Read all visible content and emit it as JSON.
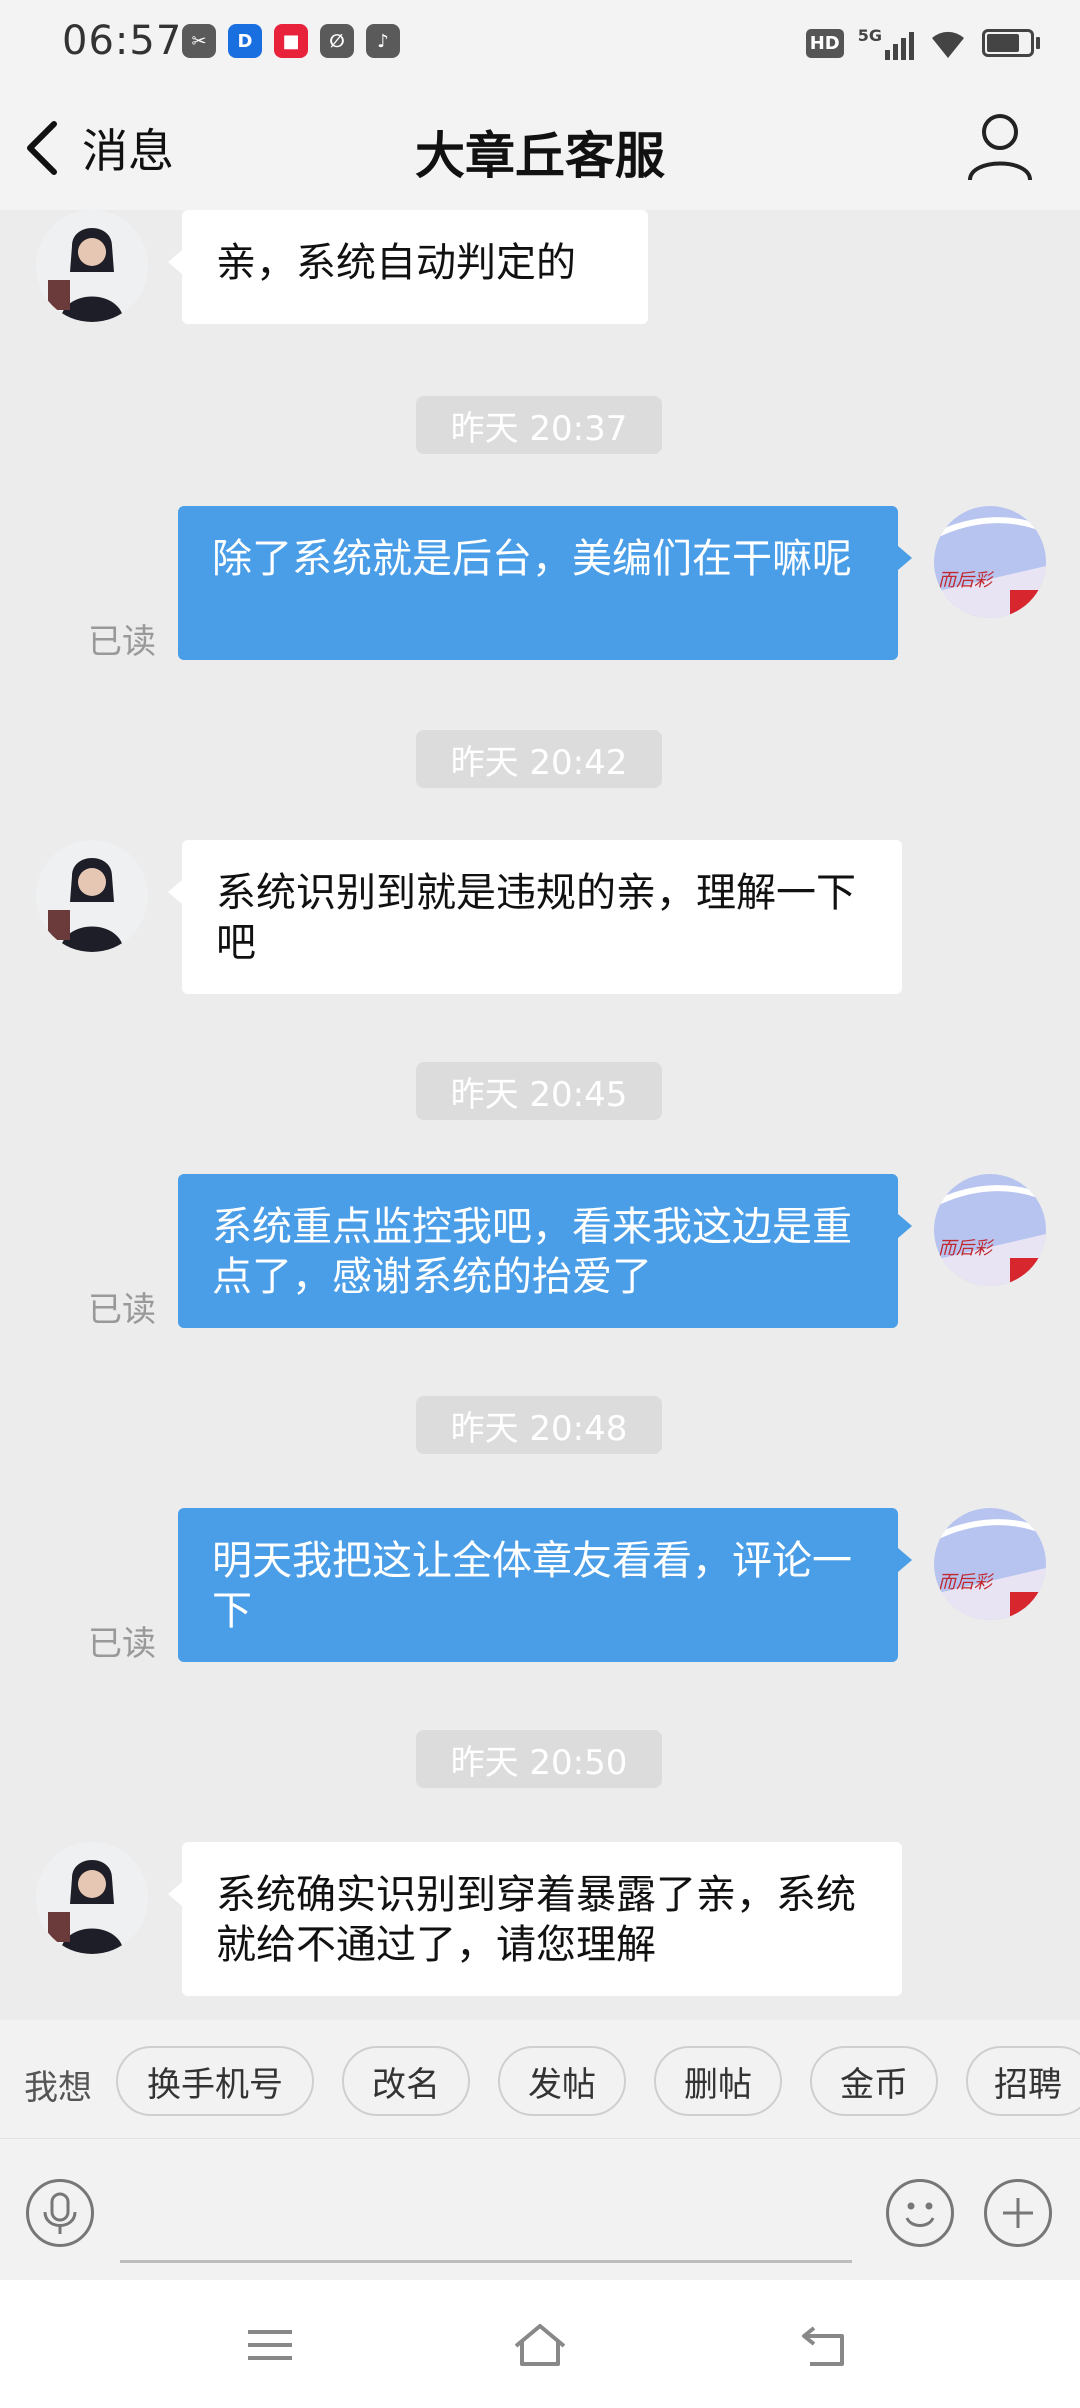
{
  "status_bar": {
    "time": "06:57",
    "notif_icons": [
      "scissors-app-icon",
      "d-app-icon",
      "red-app-icon",
      "leaf-app-icon",
      "music-app-icon"
    ],
    "hd": "HD",
    "network": "5G"
  },
  "header": {
    "back_label": "消息",
    "title": "大章丘客服"
  },
  "messages": [
    {
      "type": "in",
      "text": "亲，系统自动判定的"
    },
    {
      "type": "time",
      "text": "昨天 20:37"
    },
    {
      "type": "out",
      "text": "除了系统就是后台，美编们在干嘛呢",
      "status": "已读"
    },
    {
      "type": "time",
      "text": "昨天 20:42"
    },
    {
      "type": "in",
      "text": "系统识别到就是违规的亲，理解一下吧"
    },
    {
      "type": "time",
      "text": "昨天 20:45"
    },
    {
      "type": "out",
      "text": "系统重点监控我吧，看来我这边是重点了，感谢系统的抬爱了",
      "status": "已读"
    },
    {
      "type": "time",
      "text": "昨天 20:48"
    },
    {
      "type": "out",
      "text": "明天我把这让全体章友看看，评论一下",
      "status": "已读"
    },
    {
      "type": "time",
      "text": "昨天 20:50"
    },
    {
      "type": "in",
      "text": "系统确实识别到穿着暴露了亲，系统就给不通过了，请您理解"
    }
  ],
  "quick_replies": {
    "prefix": "我想",
    "items": [
      "换手机号",
      "改名",
      "发帖",
      "删帖",
      "金币",
      "招聘"
    ]
  },
  "colors": {
    "outgoing_bubble": "#4a9ee8",
    "incoming_bubble": "#ffffff",
    "background": "#ececec"
  }
}
